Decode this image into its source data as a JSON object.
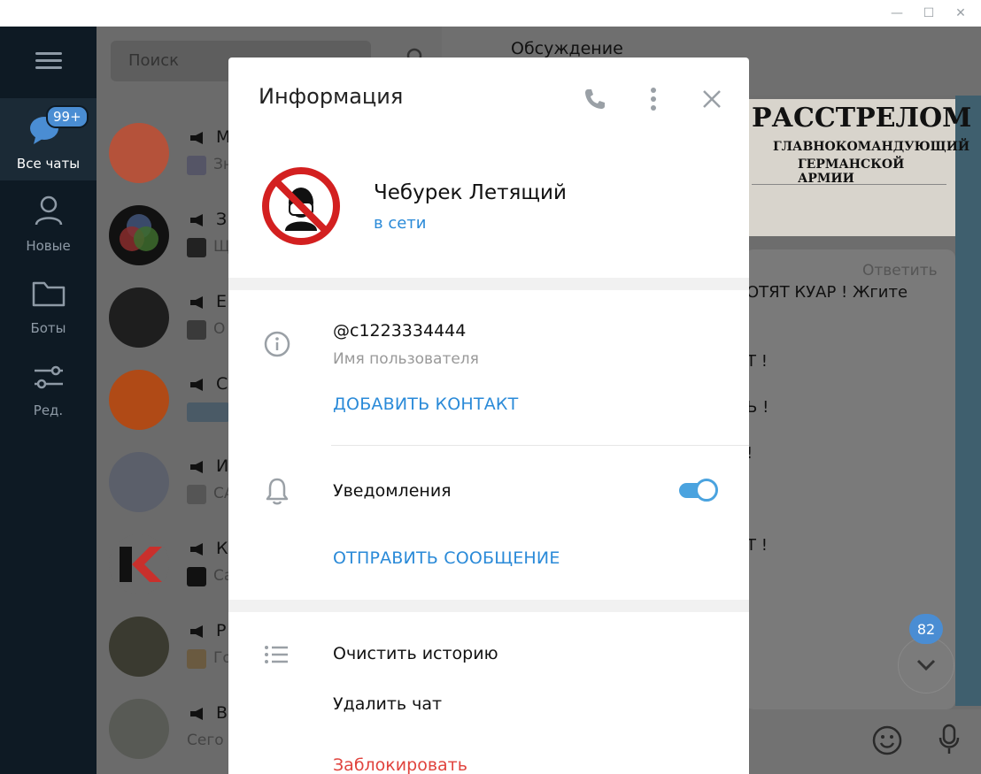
{
  "window": {
    "minimize_glyph": "—",
    "maximize_glyph": "☐",
    "close_glyph": "✕"
  },
  "rail": {
    "items": [
      {
        "label": "Все чаты",
        "badge": "99+",
        "icon": "chats-icon"
      },
      {
        "label": "Новые",
        "icon": "user-icon"
      },
      {
        "label": "Боты",
        "icon": "folder-icon"
      },
      {
        "label": "Ред.",
        "icon": "sliders-icon"
      }
    ]
  },
  "chatlist": {
    "search_placeholder": "Поиск",
    "rows": [
      {
        "name": "М",
        "preview": "Зн"
      },
      {
        "name": "З",
        "preview": "Щ"
      },
      {
        "name": "Е",
        "preview": "О"
      },
      {
        "name": "С",
        "preview": ""
      },
      {
        "name": "И",
        "preview": "СА"
      },
      {
        "name": "К",
        "preview": "Са"
      },
      {
        "name": "Р",
        "preview": "Го"
      },
      {
        "name": "В",
        "preview": "Сего"
      }
    ]
  },
  "chatpane": {
    "title": "Обсуждение",
    "news_lines": [
      "РАССТРЕЛОМ",
      "ГЛАВНОКОМАНДУЮЩИЙ",
      "ГЕРМАНСКОЙ АРМИИ"
    ],
    "reply_label": "Ответить",
    "messages": [
      "ОТЯТ КУАР ! Жгите",
      "Т !",
      "Ь !",
      "!",
      "Т !"
    ],
    "unread_count": "82"
  },
  "modal": {
    "title": "Информация",
    "profile": {
      "name": "Чебурек Летящий",
      "status": "в сети"
    },
    "username": "@c1223334444",
    "username_label": "Имя пользователя",
    "add_contact": "ДОБАВИТЬ КОНТАКТ",
    "notifications_label": "Уведомления",
    "notifications_on": true,
    "send_message": "ОТПРАВИТЬ СООБЩЕНИЕ",
    "clear_history": "Очистить историю",
    "delete_chat": "Удалить чат",
    "block": "Заблокировать"
  },
  "colors": {
    "accent": "#2a8ad8",
    "danger": "#e0433d",
    "toggle": "#4aa3df"
  }
}
